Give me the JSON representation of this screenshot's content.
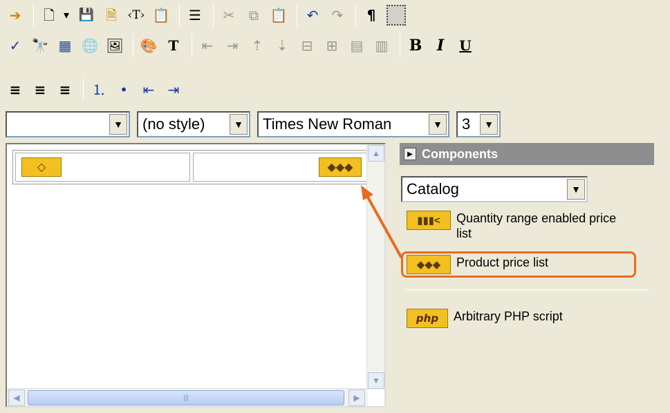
{
  "toolbar": {
    "row1": [
      {
        "name": "exit-icon",
        "glyph": "➔",
        "enabled": true
      },
      {
        "name": "new-document-icon",
        "glyph": "🗋",
        "enabled": true
      },
      {
        "name": "new-dropdown-icon",
        "glyph": "▾",
        "enabled": true
      },
      {
        "name": "save-icon",
        "glyph": "💾",
        "enabled": true
      },
      {
        "name": "save-as-template-icon",
        "glyph": "🗎",
        "enabled": true
      },
      {
        "name": "insert-tag-icon",
        "glyph": "‹T›",
        "enabled": true
      },
      {
        "name": "properties-icon",
        "glyph": "📋",
        "enabled": true
      },
      {
        "name": "page-properties-icon",
        "glyph": "☰",
        "enabled": true
      },
      {
        "name": "cut-icon",
        "glyph": "✂",
        "enabled": false
      },
      {
        "name": "copy-icon",
        "glyph": "⧉",
        "enabled": false
      },
      {
        "name": "paste-icon",
        "glyph": "📋",
        "enabled": true
      },
      {
        "name": "undo-icon",
        "glyph": "↶",
        "enabled": true
      },
      {
        "name": "redo-icon",
        "glyph": "↷",
        "enabled": false
      },
      {
        "name": "paragraph-marks-icon",
        "glyph": "¶",
        "enabled": true
      },
      {
        "name": "show-borders-icon",
        "glyph": "",
        "enabled": true
      }
    ],
    "row2": [
      {
        "name": "spellcheck-icon",
        "glyph": "✓",
        "enabled": true
      },
      {
        "name": "find-icon",
        "glyph": "🔭",
        "enabled": true
      },
      {
        "name": "insert-table-icon",
        "glyph": "▦",
        "enabled": true
      },
      {
        "name": "insert-link-icon",
        "glyph": "🌐",
        "enabled": false
      },
      {
        "name": "insert-image-icon",
        "glyph": "🖼",
        "enabled": true
      },
      {
        "name": "background-color-icon",
        "glyph": "🎨",
        "enabled": true
      },
      {
        "name": "text-color-icon",
        "glyph": "T",
        "enabled": true
      },
      {
        "name": "insert-row-above-icon",
        "glyph": "⇤",
        "enabled": false
      },
      {
        "name": "insert-row-below-icon",
        "glyph": "⇥",
        "enabled": false
      },
      {
        "name": "insert-column-left-icon",
        "glyph": "⇡",
        "enabled": false
      },
      {
        "name": "insert-column-right-icon",
        "glyph": "⇣",
        "enabled": false
      },
      {
        "name": "delete-row-icon",
        "glyph": "⊟",
        "enabled": false
      },
      {
        "name": "delete-column-icon",
        "glyph": "⊞",
        "enabled": false
      },
      {
        "name": "merge-cells-icon",
        "glyph": "▤",
        "enabled": false
      },
      {
        "name": "split-cell-icon",
        "glyph": "▥",
        "enabled": false
      }
    ],
    "bold": "B",
    "italic": "I",
    "underline": "U",
    "row3": [
      {
        "name": "align-left-icon",
        "glyph": "≡"
      },
      {
        "name": "align-center-icon",
        "glyph": "≡"
      },
      {
        "name": "align-right-icon",
        "glyph": "≡"
      },
      {
        "name": "numbered-list-icon",
        "glyph": "⒈"
      },
      {
        "name": "bullet-list-icon",
        "glyph": "•"
      },
      {
        "name": "outdent-icon",
        "glyph": "⇤"
      },
      {
        "name": "indent-icon",
        "glyph": "⇥"
      }
    ]
  },
  "format": {
    "block": "",
    "style": "(no style)",
    "font": "Times New Roman",
    "size": "3"
  },
  "editor": {
    "left_badge": "◇",
    "right_badge": "◆◆◆"
  },
  "panel": {
    "title": "Components",
    "catalog": "Catalog",
    "items": [
      {
        "icon": "▮▮▮<",
        "label_line1": "Quantity range enabled price",
        "label_line2": "list"
      },
      {
        "icon": "◆◆◆",
        "label_line1": "Product price list",
        "label_line2": ""
      },
      {
        "icon": "php",
        "label_line1": "Arbitrary PHP script",
        "label_line2": ""
      }
    ]
  },
  "colors": {
    "highlight": "#ea6a20",
    "component_gold": "#f2c020",
    "panel_header": "#8e8e8e"
  }
}
